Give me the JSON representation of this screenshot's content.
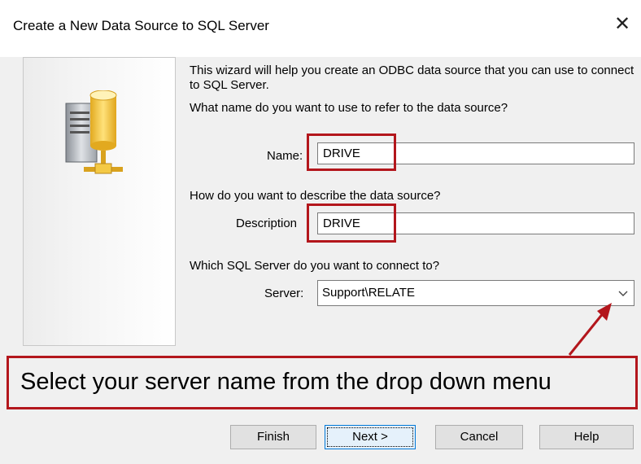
{
  "window": {
    "title": "Create a New Data Source to SQL Server",
    "close_glyph": "✕"
  },
  "intro": {
    "line1": "This wizard will help you create an ODBC data source that you can use to connect to SQL Server.",
    "question_name": "What name do you want to use to refer to the data source?"
  },
  "name_field": {
    "label": "Name:",
    "value": "DRIVE"
  },
  "description_section": {
    "question": "How do you want to describe the data source?",
    "label": "Description",
    "value": "DRIVE"
  },
  "server_section": {
    "question": "Which SQL Server do you want to connect to?",
    "label": "Server:",
    "selected": "Support\\RELATE"
  },
  "annotation": {
    "callout_text": "Select your server name from the drop down menu",
    "highlight_color": "#b3161c"
  },
  "buttons": {
    "finish": "Finish",
    "next": "Next >",
    "cancel": "Cancel",
    "help": "Help"
  }
}
